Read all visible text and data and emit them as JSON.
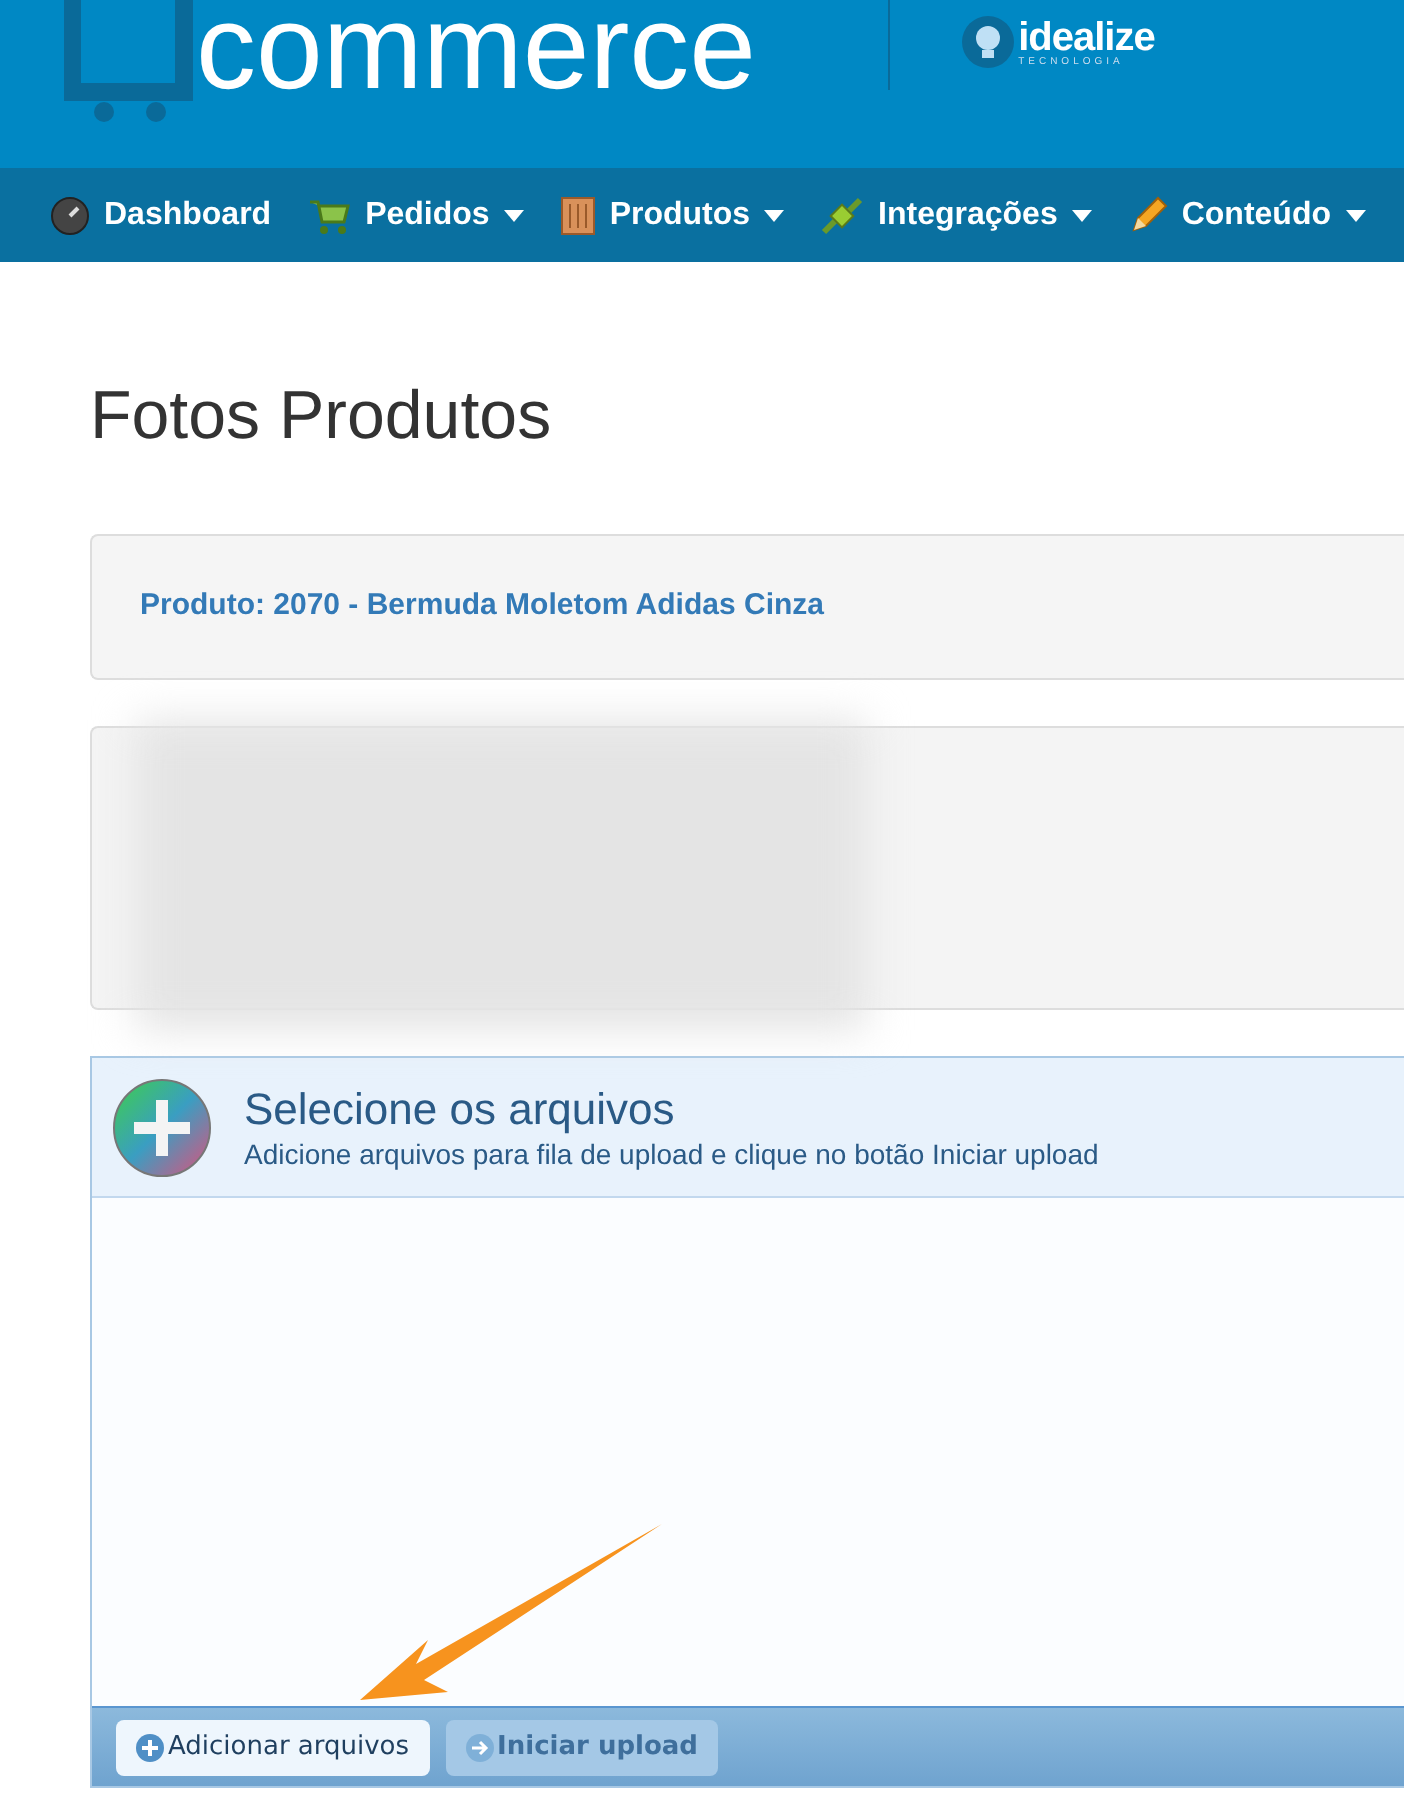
{
  "header": {
    "logo_text": "commerce",
    "partner_logo": "idealize",
    "partner_tagline": "TECNOLOGIA"
  },
  "nav": [
    {
      "label": "Dashboard",
      "dropdown": false
    },
    {
      "label": "Pedidos",
      "dropdown": true
    },
    {
      "label": "Produtos",
      "dropdown": true
    },
    {
      "label": "Integrações",
      "dropdown": true
    },
    {
      "label": "Conteúdo",
      "dropdown": true
    }
  ],
  "page_title": "Fotos Produtos",
  "product_panel": {
    "text": "Produto: 2070 - Bermuda Moletom Adidas Cinza"
  },
  "uploader": {
    "title": "Selecione os arquivos",
    "subtitle": "Adicione arquivos para fila de upload e clique no botão Iniciar upload",
    "buttons": [
      {
        "label": "Adicionar arquivos",
        "disabled": false
      },
      {
        "label": "Iniciar upload",
        "disabled": true
      }
    ]
  }
}
